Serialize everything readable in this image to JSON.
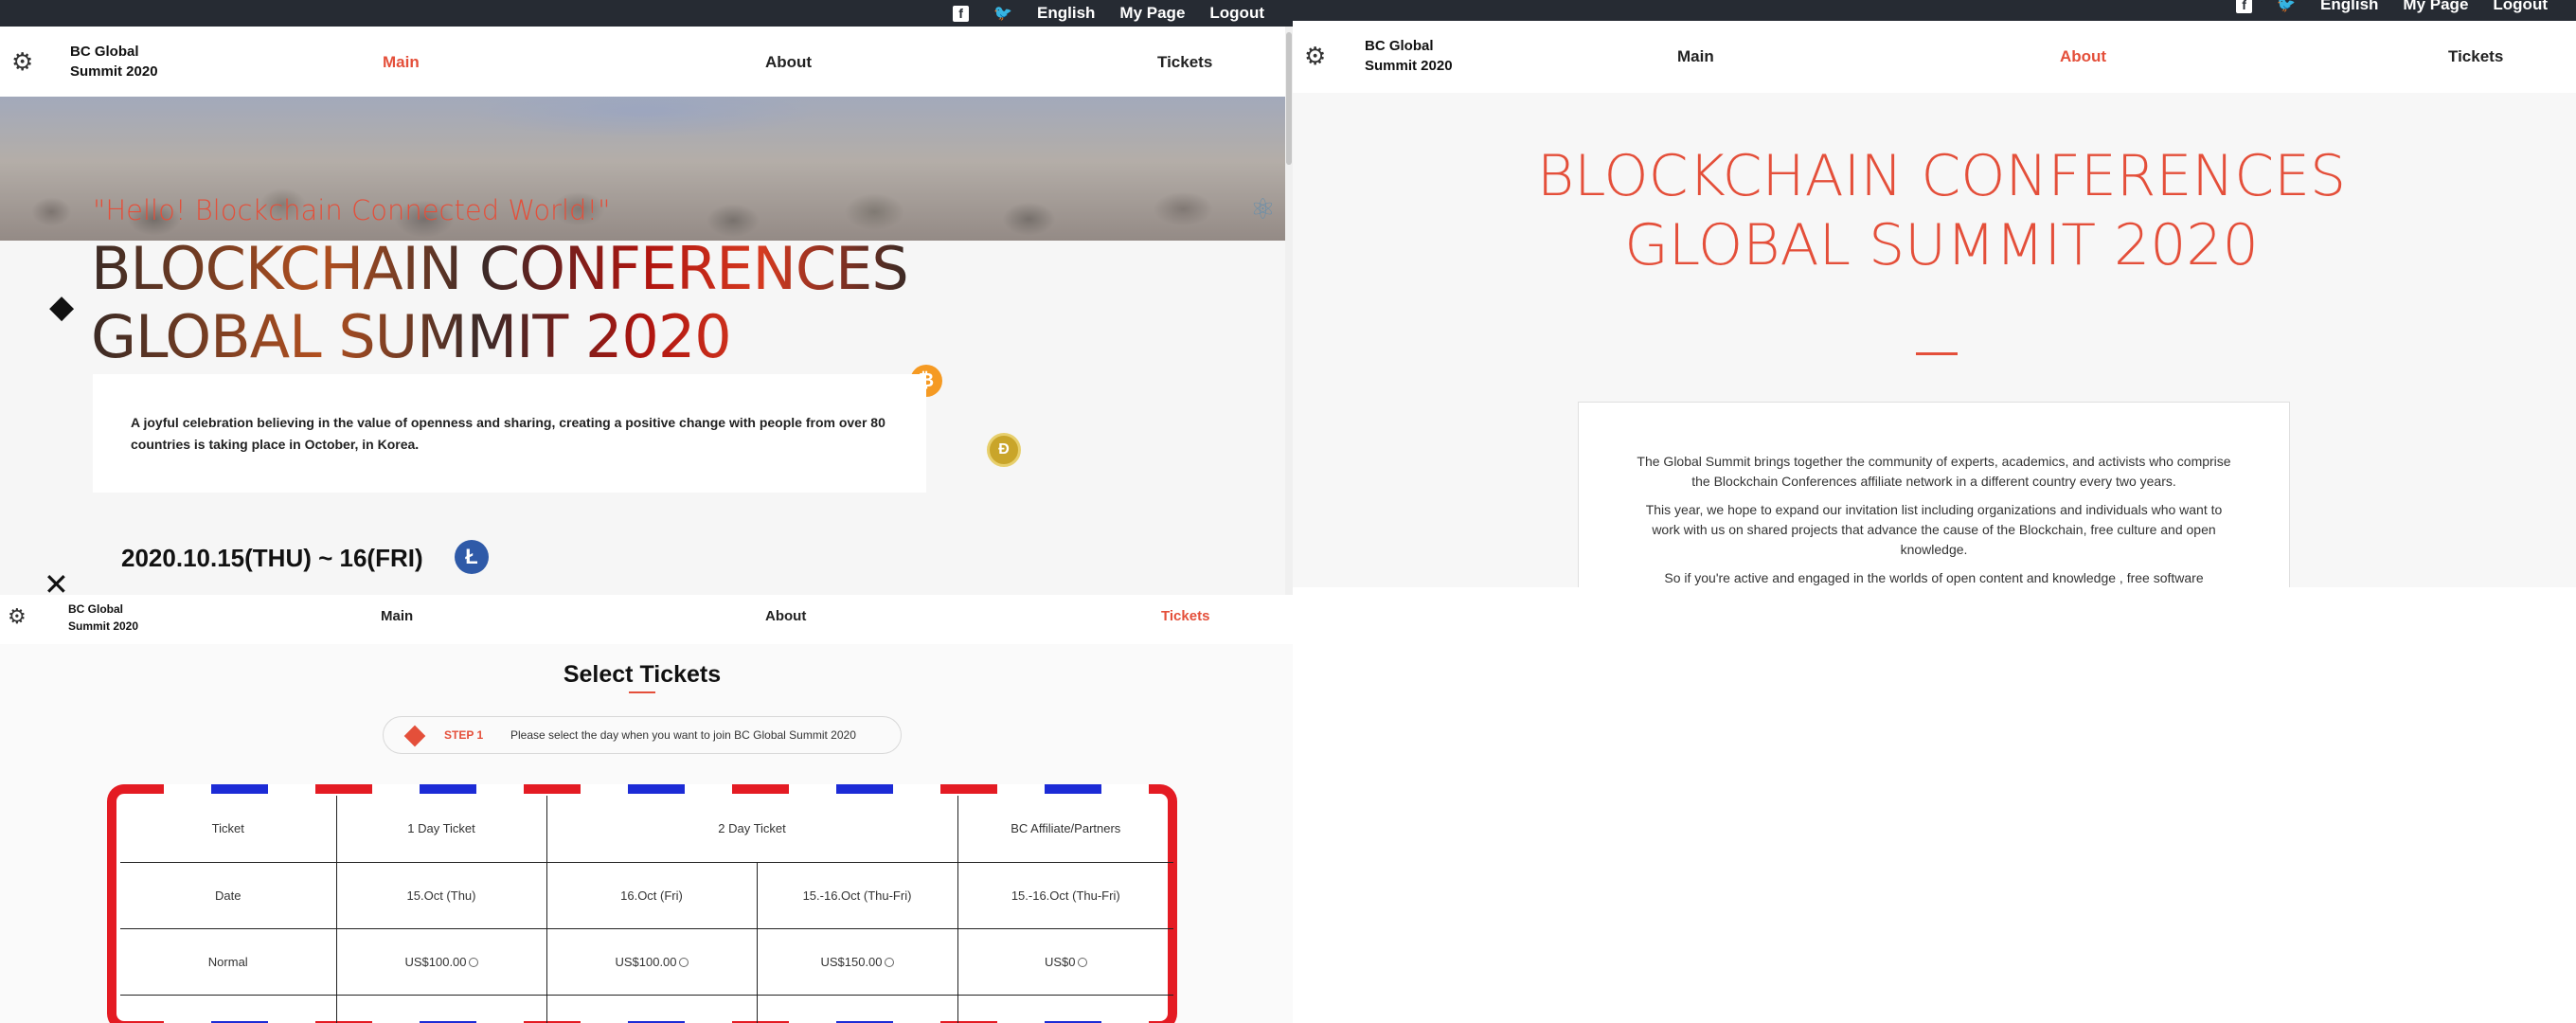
{
  "header": {
    "brand_line1": "BC Global",
    "brand_line2": "Summit 2020",
    "language": "English",
    "my_page": "My Page",
    "logout": "Logout",
    "facebook_icon": "f",
    "twitter_icon": "🐦"
  },
  "nav": {
    "main": "Main",
    "about": "About",
    "tickets": "Tickets"
  },
  "main_page": {
    "hello": "\"Hello! Blockchain Connected World!\"",
    "title_line1": "BLOCKCHAIN CONFERENCES",
    "title_line2": "GLOBAL SUMMIT 2020",
    "description": "A joyful celebration believing in the value of openness and sharing, creating a positive change with people from over 80 countries is taking place in October, in Korea.",
    "date": "2020.10.15(THU) ~ 16(FRI)",
    "icons": {
      "btc": "₿",
      "doge": "Ð",
      "ltc": "Ł",
      "eth": "◆",
      "xrp": "✕",
      "atom": "⚛"
    }
  },
  "about_page": {
    "title": "BLOCKCHAIN CONFERENCES GLOBAL SUMMIT 2020",
    "para1": "The Global Summit brings together the community of experts, academics, and activists who comprise the Blockchain Conferences affiliate network in a different country every two years.",
    "para2": "This year, we hope to expand our invitation list including organizations and individuals who want to work with us on shared projects that advance the cause of the Blockchain, free culture and open knowledge.",
    "para3": "So if you're active and engaged in the worlds of open content and knowledge , free software"
  },
  "tickets_page": {
    "title": "Select Tickets",
    "step_label": "STEP 1",
    "step_msg": "Please select the day when you want to join BC Global Summit 2020",
    "table": {
      "headers": [
        "Ticket",
        "1 Day Ticket",
        "2 Day Ticket",
        "BC Affiliate/Partners"
      ],
      "dates": [
        "Date",
        "15.Oct (Thu)",
        "16.Oct (Fri)",
        "15.-16.Oct (Thu-Fri)",
        "15.-16.Oct (Thu-Fri)"
      ],
      "normal": [
        "Normal",
        "US$100.00",
        "US$100.00",
        "US$150.00",
        "US$0"
      ]
    }
  }
}
